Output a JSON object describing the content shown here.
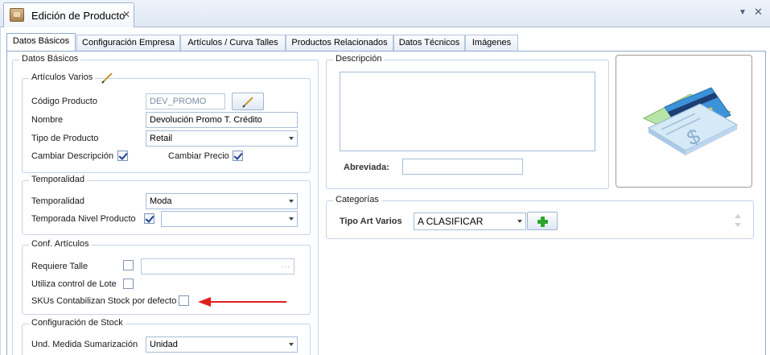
{
  "window": {
    "tab_title": "Edición de Producto",
    "close_symbol": "✕",
    "menu_symbol": "▼",
    "window_close_symbol": "✕"
  },
  "tabs": [
    {
      "label": "Datos Básicos",
      "active": true
    },
    {
      "label": "Configuración Empresa"
    },
    {
      "label": "Artículos / Curva Talles"
    },
    {
      "label": "Productos Relacionados"
    },
    {
      "label": "Datos Técnicos"
    },
    {
      "label": "Imágenes"
    }
  ],
  "datos_basicos": {
    "title": "Datos Básicos",
    "articulos_varios": {
      "title": "Artículos Varios",
      "codigo_label": "Código Producto",
      "codigo_value": "DEV_PROMO",
      "nombre_label": "Nombre",
      "nombre_value": "Devolución Promo T. Crédito",
      "tipo_label": "Tipo de Producto",
      "tipo_value": "Retail",
      "cambiar_desc_label": "Cambiar Descripción",
      "cambiar_desc_checked": true,
      "cambiar_precio_label": "Cambiar Precio",
      "cambiar_precio_checked": true
    },
    "temporalidad": {
      "title": "Temporalidad",
      "temporalidad_label": "Temporalidad",
      "temporalidad_value": "Moda",
      "nivel_label": "Temporada Nivel Producto",
      "nivel_checked": true,
      "nivel_value": ""
    },
    "conf_articulos": {
      "title": "Conf. Artículos",
      "requiere_talle_label": "Requiere Talle",
      "requiere_talle_checked": false,
      "dots": "···",
      "lote_label": "Utiliza control de Lote",
      "lote_checked": false,
      "skus_label": "SKUs Contabilizan Stock por defecto",
      "skus_checked": false
    },
    "config_stock": {
      "title": "Configuración de Stock",
      "und_label": "Und. Medida Sumarización",
      "und_value": "Unidad"
    }
  },
  "descripcion": {
    "title": "Descripción",
    "value": "",
    "abreviada_label": "Abreviada:",
    "abreviada_value": ""
  },
  "categorias": {
    "title": "Categorías",
    "tipo_label": "Tipo Art Varios",
    "tipo_value": "A CLASIFICAR"
  },
  "colors": {
    "accent_border": "#8fa9cc",
    "annotation_arrow": "#e02020",
    "add_green": "#2fa52f"
  },
  "icons": {
    "doc": "product-box-icon",
    "edit": "pencil-icon",
    "add": "plus-icon",
    "image": "credit-card-check-icon"
  }
}
